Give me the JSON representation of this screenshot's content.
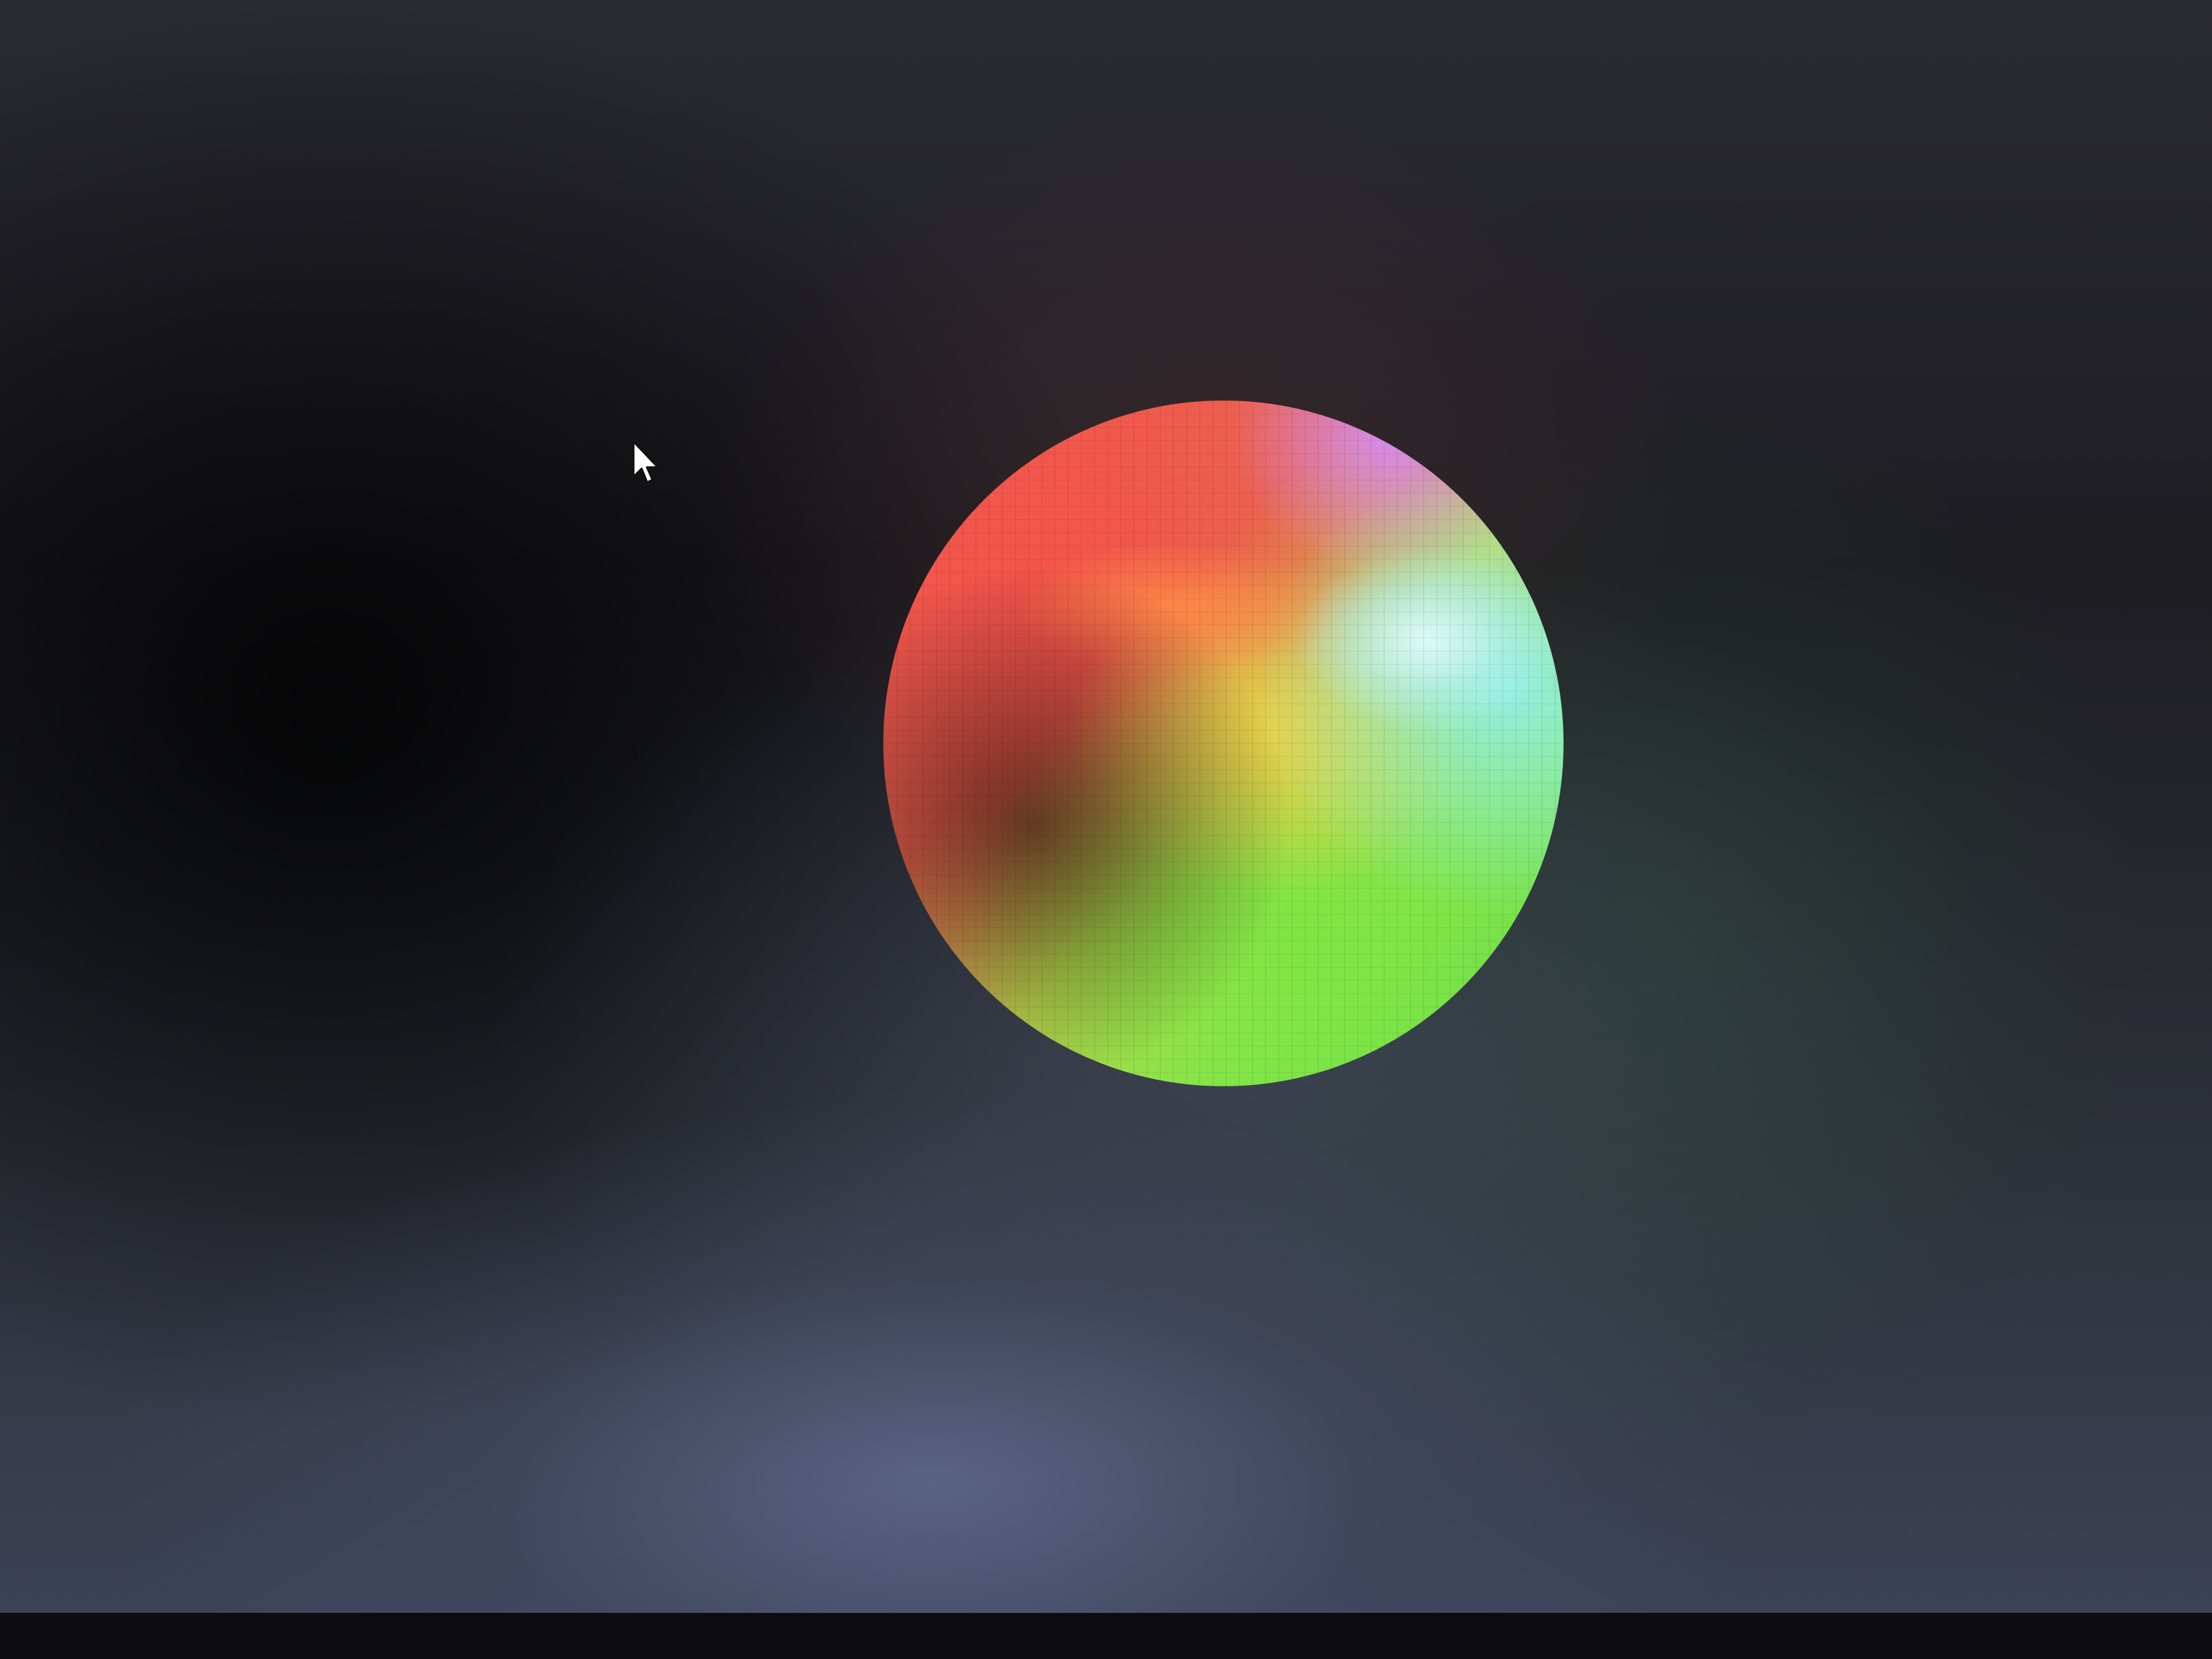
{
  "screen": {
    "background_dark": "#1e1d22",
    "background_glow": "#5a6283"
  },
  "sphere": {
    "description_colors": [
      "#f4524a",
      "#e7d24a",
      "#7fe543",
      "#8ff0e4",
      "#d48cf2"
    ]
  },
  "icons": {
    "cursor": "mouse-pointer-icon"
  }
}
